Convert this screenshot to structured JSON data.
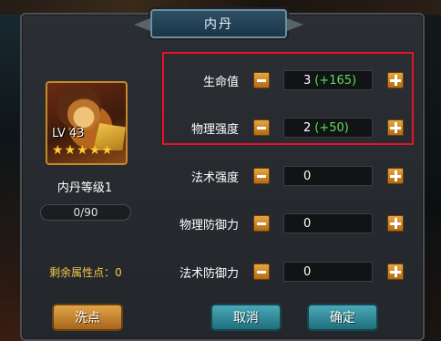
{
  "window": {
    "title": "内丹"
  },
  "hero": {
    "level_text": "LV 43",
    "stars": 5,
    "star_glyph": "★"
  },
  "dan": {
    "level_label": "内丹等级1",
    "progress_text": "0/90",
    "progress_fraction": 0,
    "remaining_points_label": "剩余属性点：0"
  },
  "attributes": [
    {
      "label": "生命值",
      "value": "3",
      "bonus": "(+165)"
    },
    {
      "label": "物理强度",
      "value": "2",
      "bonus": "(+50)"
    },
    {
      "label": "法术强度",
      "value": "0",
      "bonus": ""
    },
    {
      "label": "物理防御力",
      "value": "0",
      "bonus": ""
    },
    {
      "label": "法术防御力",
      "value": "0",
      "bonus": ""
    }
  ],
  "buttons": {
    "wash": "洗点",
    "cancel": "取消",
    "confirm": "确定"
  },
  "colors": {
    "accent_gold": "#f5c74a",
    "bonus_green": "#5ddc5d",
    "highlight_red": "#e8102a",
    "button_teal": "#1f6f7c",
    "button_orange": "#a8651c"
  }
}
